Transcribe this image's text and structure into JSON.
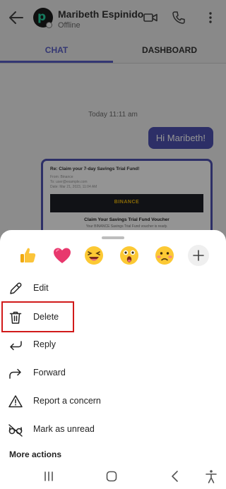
{
  "header": {
    "avatar_letter": "p",
    "contact_name": "Maribeth Espinido",
    "contact_status": "Offline"
  },
  "tabs": [
    {
      "label": "CHAT",
      "selected": true
    },
    {
      "label": "DASHBOARD",
      "selected": false
    }
  ],
  "conversation": {
    "timestamp": "Today 11:11 am",
    "outgoing_message": "Hi Maribeth!",
    "attachment": {
      "subject": "Re: Claim your 7-day Savings Trial Fund!",
      "from_lines": [
        "From: Binance",
        "To: user@example.com",
        "Date: Mar 21, 2023, 11:04 AM"
      ],
      "banner_label": "BINANCE",
      "heading": "Claim Your Savings Trial Fund Voucher",
      "body": "Your BINANCE Savings Trial Fund voucher is ready."
    }
  },
  "reactions": [
    {
      "name": "like-reaction",
      "icon": "thumbs-up"
    },
    {
      "name": "heart-reaction",
      "icon": "heart"
    },
    {
      "name": "laugh-reaction",
      "icon": "laughing-face"
    },
    {
      "name": "surprised-reaction",
      "icon": "surprised-face"
    },
    {
      "name": "sad-reaction",
      "icon": "sad-face"
    }
  ],
  "actions": [
    {
      "label": "Edit",
      "icon": "pencil-icon"
    },
    {
      "label": "Delete",
      "icon": "trash-icon",
      "highlighted": true
    },
    {
      "label": "Reply",
      "icon": "reply-icon"
    },
    {
      "label": "Forward",
      "icon": "forward-icon"
    },
    {
      "label": "Report a concern",
      "icon": "warning-icon"
    },
    {
      "label": "Mark as unread",
      "icon": "unread-glasses-icon"
    }
  ],
  "more_actions_label": "More actions",
  "colors": {
    "brand": "#5b5fc7",
    "bubble": "#4f52b2",
    "highlight": "#d11a1a"
  }
}
